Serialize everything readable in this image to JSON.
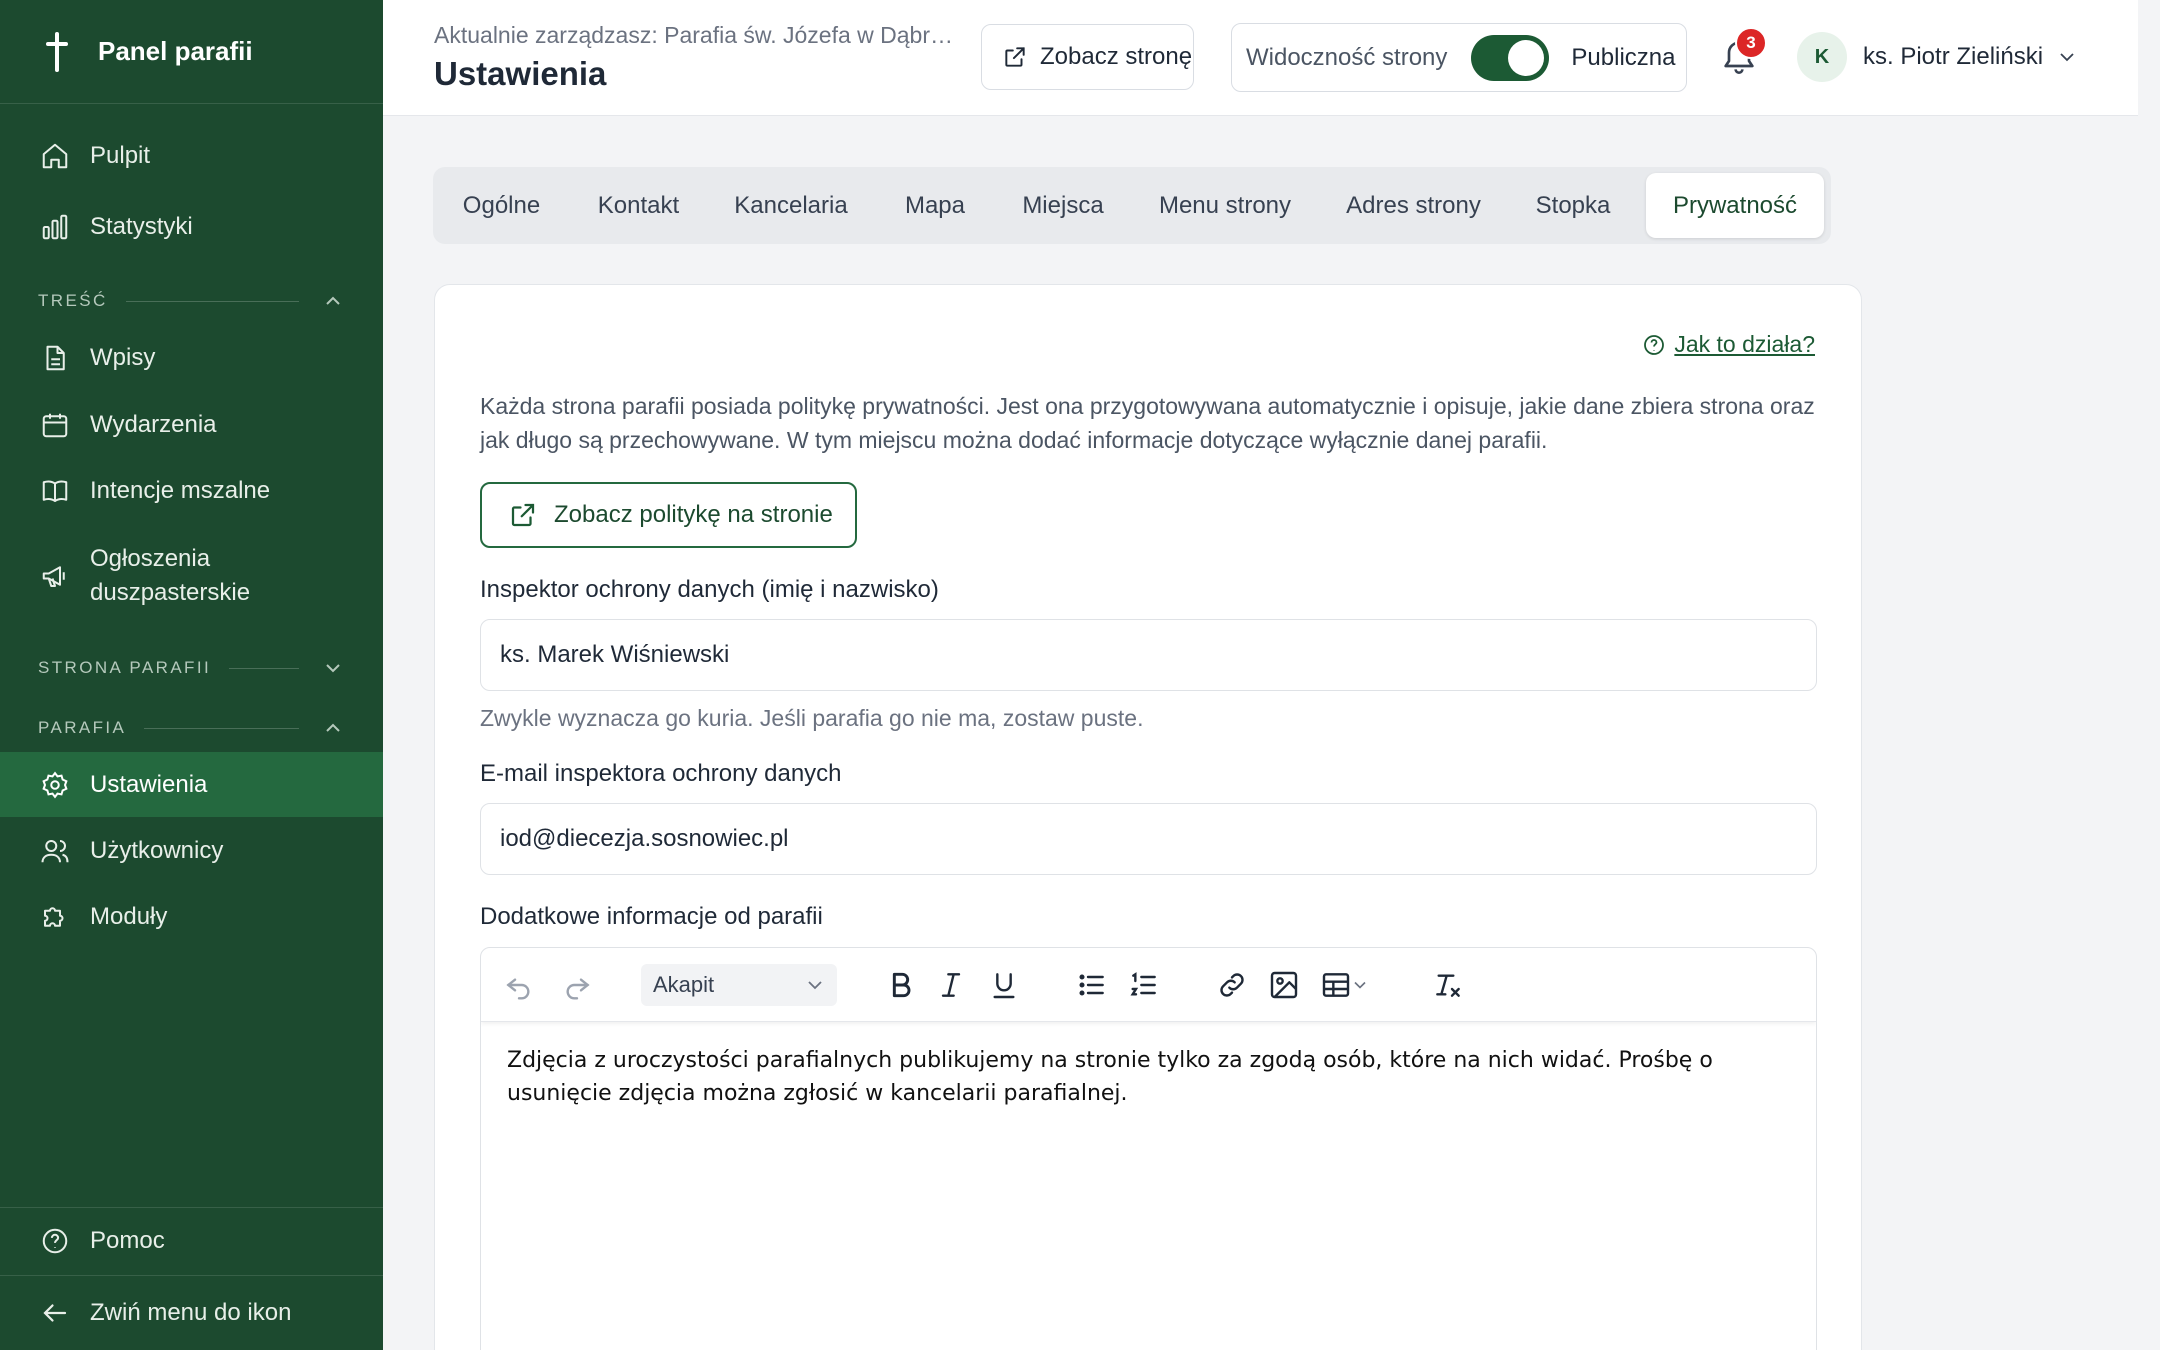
{
  "sidebar": {
    "title": "Panel parafii",
    "items": {
      "pulpit": "Pulpit",
      "statystyki": "Statystyki",
      "wpisy": "Wpisy",
      "wydarzenia": "Wydarzenia",
      "intencje": "Intencje mszalne",
      "ogloszenia_line1": "Ogłoszenia",
      "ogloszenia_line2": "duszpasterskie",
      "ustawienia": "Ustawienia",
      "uzytkownicy": "Użytkownicy",
      "moduly": "Moduły",
      "pomoc": "Pomoc",
      "zwin": "Zwiń menu do ikon"
    },
    "sections": {
      "tresc": "TREŚĆ",
      "strona": "STRONA PARAFII",
      "parafia": "PARAFIA"
    }
  },
  "header": {
    "breadcrumb": "Aktualnie zarządzasz: Parafia św. Józefa w Dąbrowie Górniczej",
    "title": "Ustawienia",
    "view_site": "Zobacz stronę",
    "visibility_label": "Widoczność strony",
    "visibility_value": "Publiczna",
    "visibility_on": true,
    "notifications_count": "3",
    "user_initial": "K",
    "user_name": "ks. Piotr Zieliński"
  },
  "tabs": [
    "Ogólne",
    "Kontakt",
    "Kancelaria",
    "Mapa",
    "Miejsca",
    "Menu strony",
    "Adres strony",
    "Stopka",
    "Prywatność"
  ],
  "active_tab": "Prywatność",
  "privacy": {
    "help_link": "Jak to działa?",
    "description": "Każda strona parafii posiada politykę prywatności. Jest ona przygotowywana automatycznie i opisuje, jakie dane zbiera strona oraz jak długo są przechowywane. W tym miejscu można dodać informacje dotyczące wyłącznie danej parafii.",
    "policy_button": "Zobacz politykę na stronie",
    "inspector_label": "Inspektor ochrony danych (imię i nazwisko)",
    "inspector_value": "ks. Marek Wiśniewski",
    "inspector_hint": "Zwykle wyznacza go kuria. Jeśli parafia go nie ma, zostaw puste.",
    "email_label": "E-mail inspektora ochrony danych",
    "email_value": "iod@diecezja.sosnowiec.pl",
    "extra_label": "Dodatkowe informacje od parafii",
    "editor": {
      "paragraph_style": "Akapit",
      "content": "Zdjęcia z uroczystości parafialnych publikujemy na stronie tylko za zgodą osób, które na nich widać. Prośbę o usunięcie zdjęcia można zgłosić w kancelarii parafialnej."
    }
  },
  "colors": {
    "sidebar_bg": "#1c4a2f",
    "sidebar_active": "#24693f",
    "accent": "#1c5a34",
    "badge": "#dc2626"
  }
}
